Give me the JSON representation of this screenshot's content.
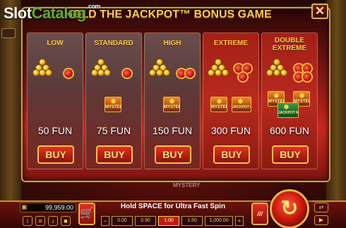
{
  "watermark": {
    "part1": "Slot",
    "part2": "Catalog",
    "suffix": ".com"
  },
  "dialog": {
    "title": "HOLD THE JACKPOT™ BONUS GAME",
    "close": "✕",
    "levels": [
      {
        "name": "LOW",
        "price": "50 FUN",
        "buy": "BUY"
      },
      {
        "name": "STANDARD",
        "price": "75 FUN",
        "buy": "BUY"
      },
      {
        "name": "HIGH",
        "price": "150 FUN",
        "buy": "BUY"
      },
      {
        "name": "EXTREME",
        "price": "300 FUN",
        "buy": "BUY"
      },
      {
        "name": "DOUBLE\nEXTREME",
        "price": "600 FUN",
        "buy": "BUY"
      }
    ],
    "mystery_label": "MYSTERY",
    "jackpot_mystery_label": "JACKPOT MYSTERY"
  },
  "background": {
    "mystery_text": "MYSTERY"
  },
  "bottom_bar": {
    "balance": "99,959.00",
    "wallet_icon": "wallet-icon",
    "hold_text": "Hold SPACE for Ultra Fast Spin",
    "bets": [
      "0.00",
      "0.90",
      "1.00",
      "1.50",
      "1,000.00"
    ],
    "selected_bet": "1.00",
    "minus": "−",
    "plus": "+",
    "info": "i",
    "menu": "≡",
    "sound": "♪",
    "turbo": "///",
    "spin": "↻"
  },
  "colors": {
    "accent_gold": "#ffc94a",
    "buy_red": "#c21a10",
    "panel_red": "#8a1b14"
  }
}
